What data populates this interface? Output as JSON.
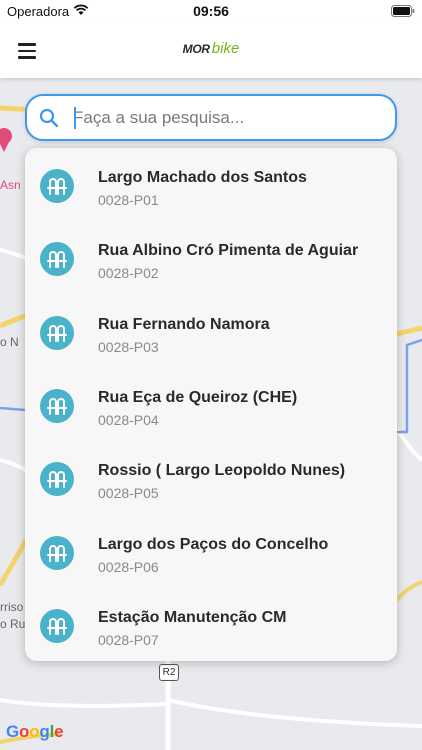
{
  "status_bar": {
    "carrier": "Operadora",
    "time": "09:56"
  },
  "header": {
    "brand_mor": "MOR",
    "brand_bike": "bike"
  },
  "search": {
    "placeholder": "Faça a sua pesquisa...",
    "value": ""
  },
  "results": [
    {
      "name": "Largo Machado dos Santos",
      "code": "0028-P01"
    },
    {
      "name": "Rua Albino Cró Pimenta de Aguiar",
      "code": "0028-P02"
    },
    {
      "name": "Rua Fernando Namora",
      "code": "0028-P03"
    },
    {
      "name": "Rua Eça de Queiroz (CHE)",
      "code": "0028-P04"
    },
    {
      "name": "Rossio ( Largo Leopoldo Nunes)",
      "code": "0028-P05"
    },
    {
      "name": "Largo dos Paços do Concelho",
      "code": "0028-P06"
    },
    {
      "name": "Estação Manutenção CM",
      "code": "0028-P07"
    }
  ],
  "map": {
    "labels": {
      "asn": "Asn",
      "o_n": "o N",
      "rriso": "rriso",
      "o_ru": "o Ru"
    },
    "road_shield": "R2",
    "attribution_letters": [
      "G",
      "o",
      "o",
      "g",
      "l",
      "e"
    ],
    "attribution_colors": [
      "#4285F4",
      "#EA4335",
      "#FBBC05",
      "#4285F4",
      "#34A853",
      "#EA4335"
    ]
  },
  "colors": {
    "accent": "#3b9af0",
    "station_icon": "#4bb3c9",
    "brand_green": "#7ab317"
  },
  "icons": {
    "menu": "hamburger-icon",
    "search": "search-icon",
    "station": "bike-rack-icon",
    "wifi": "wifi-icon",
    "battery": "battery-icon"
  }
}
